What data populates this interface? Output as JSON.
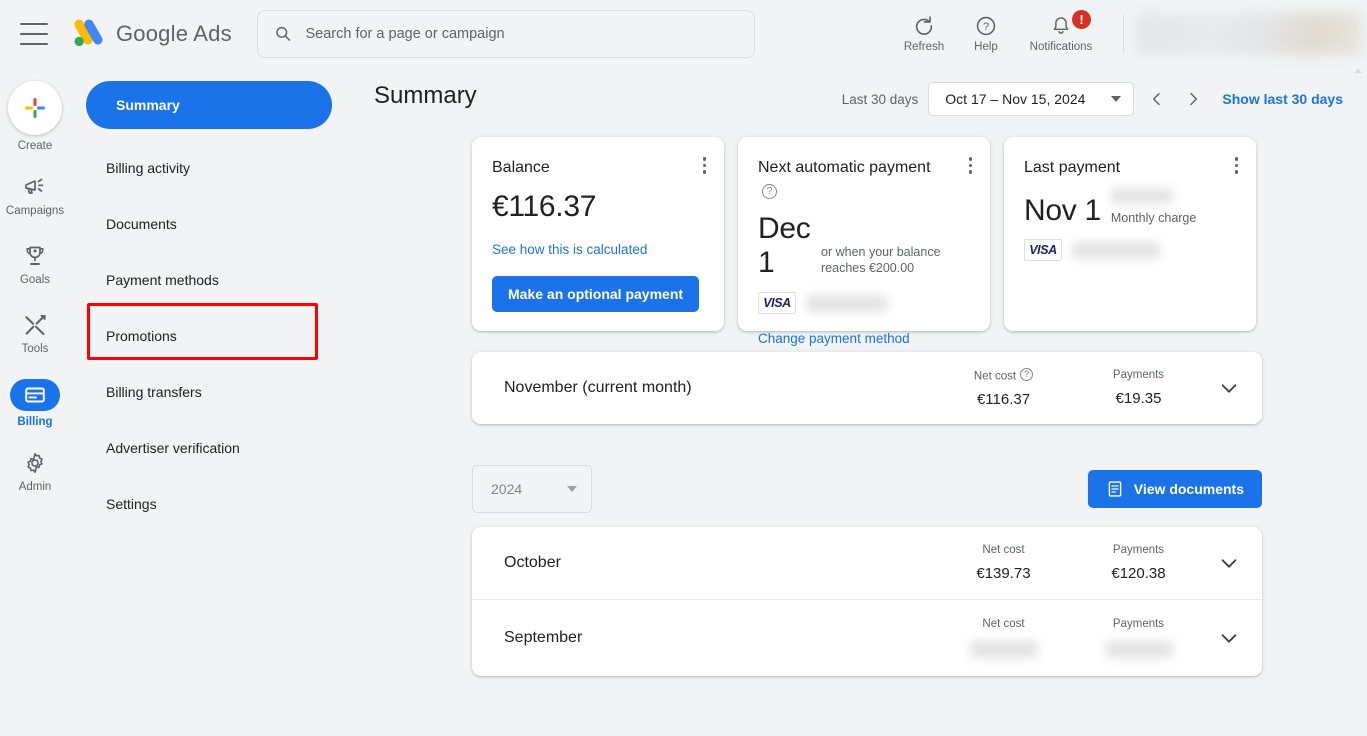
{
  "header": {
    "menu_icon": "hamburger-icon",
    "brand_google": "Google",
    "brand_ads": "Ads",
    "search": {
      "icon": "search-icon",
      "value": "",
      "placeholder": "Search for a page or campaign"
    },
    "actions": [
      {
        "icon": "refresh-icon",
        "label": "Refresh"
      },
      {
        "icon": "help-icon",
        "label": "Help"
      },
      {
        "icon": "bell-icon",
        "label": "Notifications",
        "badge": "!"
      }
    ]
  },
  "rail": {
    "items": [
      {
        "icon": "plus-icon",
        "label": "Create",
        "active": false
      },
      {
        "icon": "megaphone-icon",
        "label": "Campaigns",
        "active": false
      },
      {
        "icon": "trophy-icon",
        "label": "Goals",
        "active": false
      },
      {
        "icon": "tools-icon",
        "label": "Tools",
        "active": false
      },
      {
        "icon": "billing-card-icon",
        "label": "Billing",
        "active": true
      },
      {
        "icon": "gear-icon",
        "label": "Admin",
        "active": false
      }
    ]
  },
  "subnav": {
    "items": [
      {
        "label": "Summary",
        "active": true
      },
      {
        "label": "Billing activity",
        "active": false
      },
      {
        "label": "Documents",
        "active": false
      },
      {
        "label": "Payment methods",
        "active": false
      },
      {
        "label": "Promotions",
        "active": false,
        "highlighted": true
      },
      {
        "label": "Billing transfers",
        "active": false
      },
      {
        "label": "Advertiser verification",
        "active": false
      },
      {
        "label": "Settings",
        "active": false
      }
    ]
  },
  "main": {
    "page_title": "Summary",
    "date_label": "Last 30 days",
    "date_range": "Oct 17 – Nov 15, 2024",
    "prev_icon": "chevron-left-icon",
    "next_icon": "chevron-right-icon",
    "show_last_link": "Show last 30 days"
  },
  "cards": {
    "balance": {
      "title": "Balance",
      "amount": "€116.37",
      "link": "See how this is calculated",
      "button": "Make an optional payment"
    },
    "next_payment": {
      "title": "Next automatic payment",
      "help_icon": "help-circle-icon",
      "date": "Dec 1",
      "note": "or when your balance reaches €200.00",
      "card_brand": "VISA",
      "card_number_redacted": "",
      "link": "Change payment method"
    },
    "last_payment": {
      "title": "Last payment",
      "date": "Nov 1",
      "amount_redacted": "",
      "note": "Monthly charge",
      "card_brand": "VISA",
      "card_number_redacted": ""
    }
  },
  "months": {
    "net_cost_label": "Net cost",
    "payments_label": "Payments",
    "help_icon": "help-circle-icon",
    "expand_icon": "chevron-down-icon",
    "current": {
      "name": "November (current month)",
      "net_cost": "€116.37",
      "payments": "€19.35",
      "redacted": false
    },
    "history": [
      {
        "name": "October",
        "net_cost": "€139.73",
        "payments": "€120.38",
        "redacted": false
      },
      {
        "name": "September",
        "net_cost": "",
        "payments": "",
        "redacted": true
      }
    ]
  },
  "tools": {
    "year_value": "2024",
    "year_caret_icon": "chevron-down-icon",
    "view_documents_label": "View documents",
    "view_documents_icon": "document-icon"
  },
  "colors": {
    "accent": "#1a73e8",
    "background": "#f1f3f4",
    "card": "#ffffff",
    "text": "#202124",
    "muted": "#5f6368",
    "highlight": "#ff0000",
    "badge": "#d93025"
  }
}
